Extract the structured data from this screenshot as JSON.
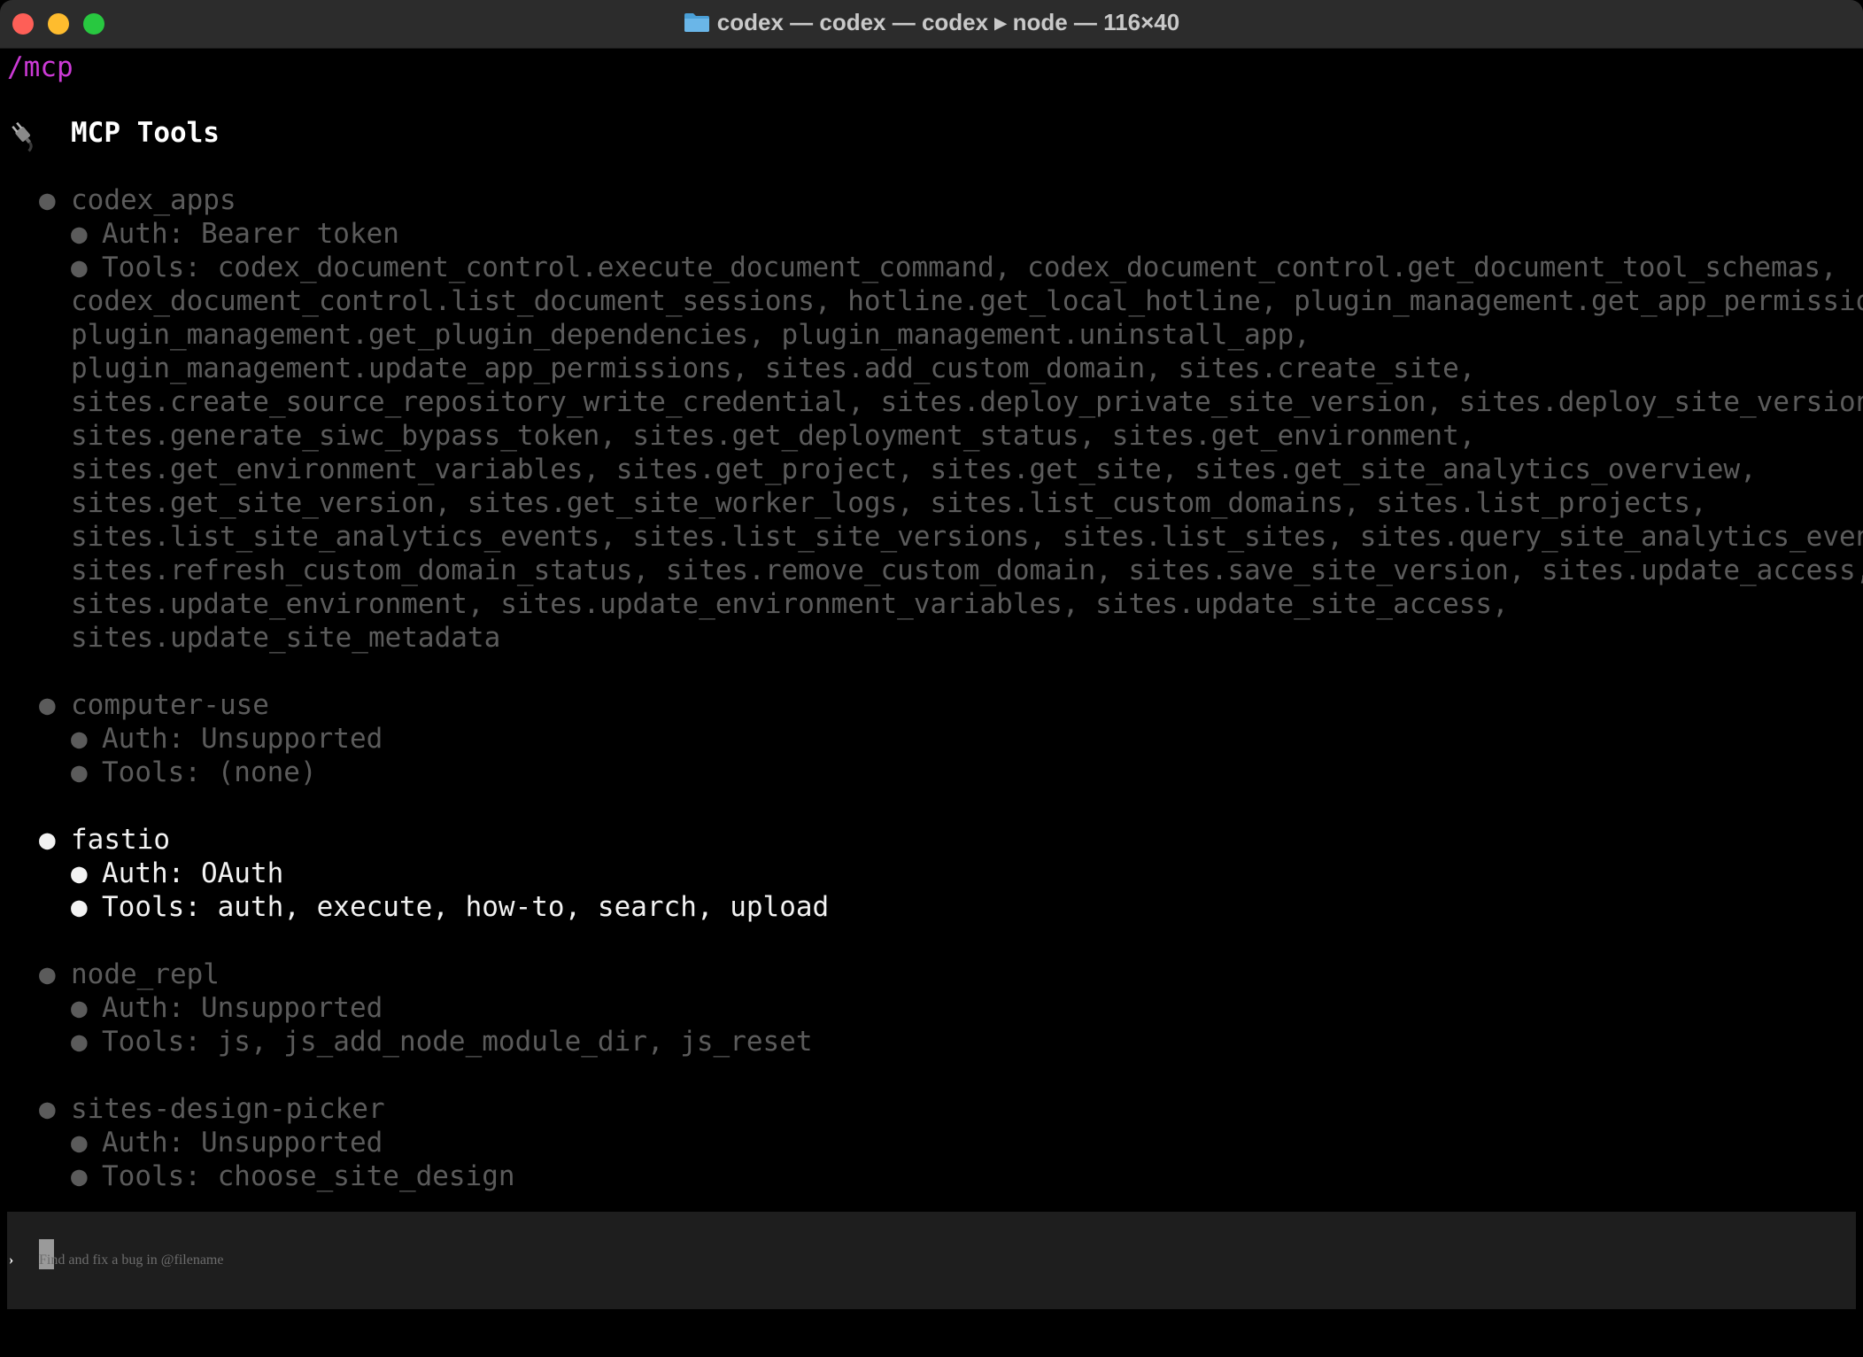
{
  "window": {
    "title": "codex — codex — codex ▸ node — 116×40",
    "folder_icon": "folder-icon"
  },
  "terminal": {
    "command": "/mcp",
    "heading": "MCP Tools",
    "heading_icon": "plug-icon",
    "servers": [
      {
        "name": "codex_apps",
        "auth": "Auth: Bearer token",
        "tools_lines": [
          "Tools: codex_document_control.execute_document_command, codex_document_control.get_document_tool_schemas,",
          "codex_document_control.list_document_sessions, hotline.get_local_hotline, plugin_management.get_app_permissions,",
          "plugin_management.get_plugin_dependencies, plugin_management.uninstall_app,",
          "plugin_management.update_app_permissions, sites.add_custom_domain, sites.create_site,",
          "sites.create_source_repository_write_credential, sites.deploy_private_site_version, sites.deploy_site_version,",
          "sites.generate_siwc_bypass_token, sites.get_deployment_status, sites.get_environment,",
          "sites.get_environment_variables, sites.get_project, sites.get_site, sites.get_site_analytics_overview,",
          "sites.get_site_version, sites.get_site_worker_logs, sites.list_custom_domains, sites.list_projects,",
          "sites.list_site_analytics_events, sites.list_site_versions, sites.list_sites, sites.query_site_analytics_event,",
          "sites.refresh_custom_domain_status, sites.remove_custom_domain, sites.save_site_version, sites.update_access,",
          "sites.update_environment, sites.update_environment_variables, sites.update_site_access,",
          "sites.update_site_metadata"
        ]
      },
      {
        "name": "computer-use",
        "auth": "Auth: Unsupported",
        "tools_lines": [
          "Tools: (none)"
        ]
      },
      {
        "name": "fastio",
        "auth": "Auth: OAuth",
        "tools_lines": [
          "Tools: auth, execute, how-to, search, upload"
        ]
      },
      {
        "name": "node_repl",
        "auth": "Auth: Unsupported",
        "tools_lines": [
          "Tools: js, js_add_node_module_dir, js_reset"
        ]
      },
      {
        "name": "sites-design-picker",
        "auth": "Auth: Unsupported",
        "tools_lines": [
          "Tools: choose_site_design"
        ]
      }
    ],
    "highlighted_server": "fastio",
    "bullet": "●"
  },
  "composer": {
    "prompt": "›",
    "placeholder_first": "F",
    "placeholder_rest": "ind and fix a bug in @filename"
  },
  "colors": {
    "background": "#000000",
    "titlebar": "#2c2c2c",
    "command": "#cc3ad6",
    "dim_text": "#5b5b5b",
    "bright_text": "#f2f2f2",
    "composer_bg": "#1e1e1e"
  }
}
